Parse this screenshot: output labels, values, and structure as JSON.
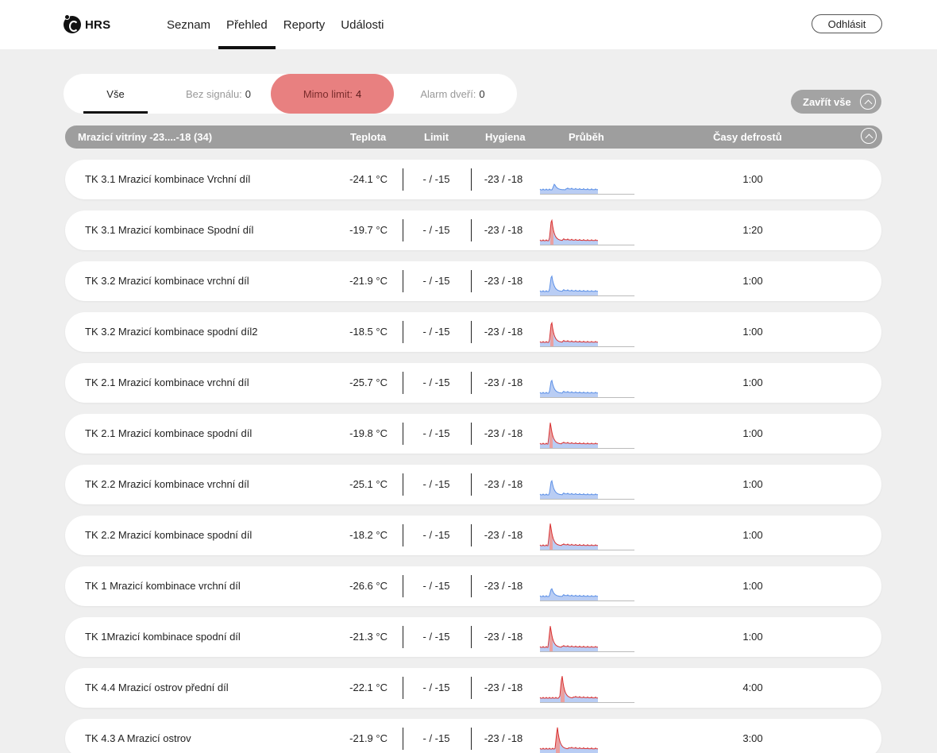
{
  "header": {
    "logo_text": "HRS",
    "nav": [
      "Seznam",
      "Přehled",
      "Reporty",
      "Události"
    ],
    "active_nav": 1,
    "logout_label": "Odhlásit"
  },
  "filters": {
    "all_label": "Vše",
    "no_signal_label": "Bez signálu:",
    "no_signal_count": "0",
    "out_of_limit_label": "Mimo limit:",
    "out_of_limit_count": "4",
    "door_alarm_label": "Alarm dveří:",
    "door_alarm_count": "0"
  },
  "close_all_label": "Zavřít vše",
  "group": {
    "title": "Mrazicí vitríny -23....-18 (34)",
    "col_temp": "Teplota",
    "col_limit": "Limit",
    "col_hygiene": "Hygiena",
    "col_chart": "Průběh",
    "col_defrost": "Časy defrostů"
  },
  "colors": {
    "accent_out_of_limit": "#e88080",
    "chart_fill": "#b9cdf4",
    "chart_line": "#5b8fe6",
    "chart_alarm": "#d93030"
  },
  "rows": [
    {
      "name": "TK 3.1 Mrazicí kombinace Vrchní díl",
      "temp": "-24.1 °C",
      "limit": "- / -15",
      "hygiene": "-23 / -18",
      "defrost": "1:00",
      "spike": 0.35,
      "peak_x": 0.25,
      "alarm": false
    },
    {
      "name": "TK 3.1 Mrazicí kombinace Spodní díl",
      "temp": "-19.7 °C",
      "limit": "- / -15",
      "hygiene": "-23 / -18",
      "defrost": "1:20",
      "spike": 0.95,
      "peak_x": 0.2,
      "alarm": true
    },
    {
      "name": "TK 3.2 Mrazicí kombinace vrchní díl",
      "temp": "-21.9 °C",
      "limit": "- / -15",
      "hygiene": "-23 / -18",
      "defrost": "1:00",
      "spike": 0.75,
      "peak_x": 0.2,
      "alarm": false
    },
    {
      "name": "TK 3.2 Mrazicí kombinace spodní díl2",
      "temp": "-18.5 °C",
      "limit": "- / -15",
      "hygiene": "-23 / -18",
      "defrost": "1:00",
      "spike": 0.92,
      "peak_x": 0.2,
      "alarm": true
    },
    {
      "name": "TK 2.1 Mrazicí kombinace vrchní díl",
      "temp": "-25.7 °C",
      "limit": "- / -15",
      "hygiene": "-23 / -18",
      "defrost": "1:00",
      "spike": 0.65,
      "peak_x": 0.2,
      "alarm": false
    },
    {
      "name": "TK 2.1 Mrazicí kombinace spodní díl",
      "temp": "-19.8 °C",
      "limit": "- / -15",
      "hygiene": "-23 / -18",
      "defrost": "1:00",
      "spike": 0.92,
      "peak_x": 0.18,
      "alarm": true
    },
    {
      "name": "TK 2.2 Mrazicí kombinace vrchní díl",
      "temp": "-25.1 °C",
      "limit": "- / -15",
      "hygiene": "-23 / -18",
      "defrost": "1:00",
      "spike": 0.7,
      "peak_x": 0.2,
      "alarm": false
    },
    {
      "name": "TK 2.2 Mrazicí kombinace spodní díl",
      "temp": "-18.2 °C",
      "limit": "- / -15",
      "hygiene": "-23 / -18",
      "defrost": "1:00",
      "spike": 0.95,
      "peak_x": 0.18,
      "alarm": true
    },
    {
      "name": "TK 1 Mrazicí kombinace vrchní díl",
      "temp": "-26.6 °C",
      "limit": "- / -15",
      "hygiene": "-23 / -18",
      "defrost": "1:00",
      "spike": 0.45,
      "peak_x": 0.2,
      "alarm": false
    },
    {
      "name": "TK 1Mrazicí kombinace spodní díl",
      "temp": "-21.3 °C",
      "limit": "- / -15",
      "hygiene": "-23 / -18",
      "defrost": "1:00",
      "spike": 0.92,
      "peak_x": 0.18,
      "alarm": true
    },
    {
      "name": "TK 4.4 Mrazicí ostrov přední díl",
      "temp": "-22.1 °C",
      "limit": "- / -15",
      "hygiene": "-23 / -18",
      "defrost": "4:00",
      "spike": 0.98,
      "peak_x": 0.38,
      "alarm": true
    },
    {
      "name": "TK 4.3 A Mrazicí ostrov",
      "temp": "-21.9 °C",
      "limit": "- / -15",
      "hygiene": "-23 / -18",
      "defrost": "3:00",
      "spike": 0.92,
      "peak_x": 0.3,
      "alarm": true
    }
  ]
}
